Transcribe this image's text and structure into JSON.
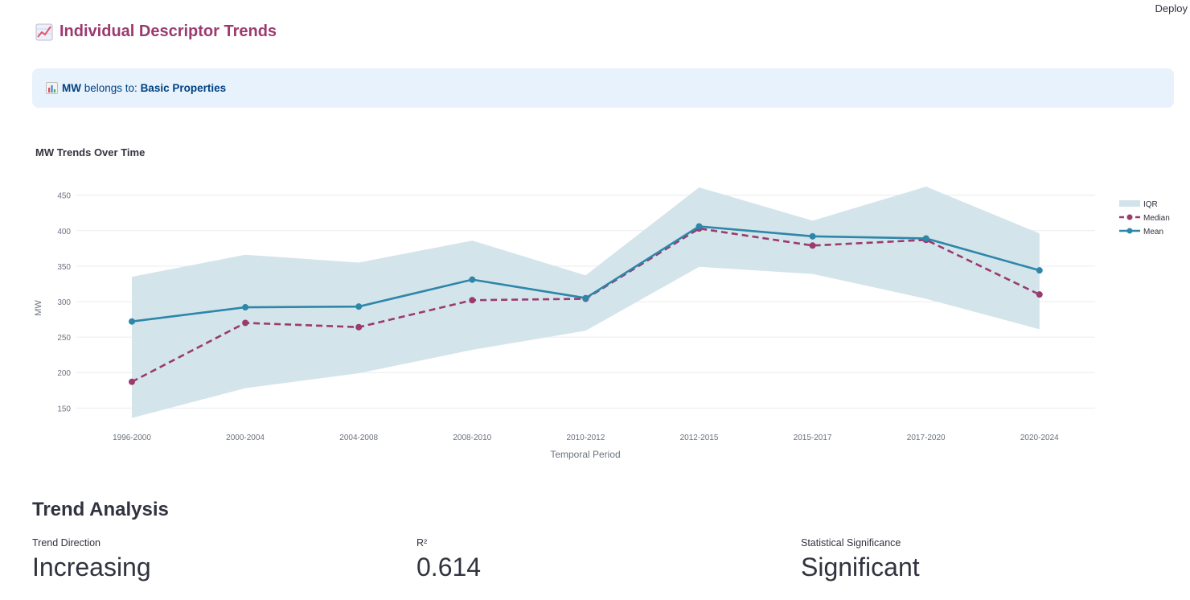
{
  "toolbar": {
    "deploy_label": "Deploy"
  },
  "page": {
    "title": "Individual Descriptor Trends"
  },
  "info": {
    "descriptor": "MW",
    "belongs_text": " belongs to: ",
    "group": "Basic Properties"
  },
  "chart_title": "MW Trends Over Time",
  "chart_data": {
    "type": "line",
    "categories": [
      "1996-2000",
      "2000-2004",
      "2004-2008",
      "2008-2010",
      "2010-2012",
      "2012-2015",
      "2015-2017",
      "2017-2020",
      "2020-2024"
    ],
    "series": [
      {
        "name": "Median",
        "values": [
          187,
          270,
          264,
          302,
          304,
          403,
          379,
          387,
          310
        ],
        "color": "#9b3a6e",
        "dash": true
      },
      {
        "name": "Mean",
        "values": [
          272,
          292,
          293,
          331,
          305,
          406,
          392,
          389,
          344
        ],
        "color": "#2e86a8",
        "dash": false
      }
    ],
    "band": {
      "name": "IQR",
      "upper": [
        335,
        366,
        355,
        386,
        337,
        461,
        414,
        462,
        396
      ],
      "lower": [
        136,
        178,
        199,
        232,
        259,
        349,
        339,
        304,
        261
      ],
      "color": "#d2e3ea"
    },
    "yticks": [
      150,
      200,
      250,
      300,
      350,
      400,
      450
    ],
    "ylim": [
      130,
      470
    ],
    "xlabel": "Temporal Period",
    "ylabel": "MW",
    "legend": "top-right",
    "grid": true
  },
  "trend": {
    "title": "Trend Analysis",
    "metrics": [
      {
        "label": "Trend Direction",
        "value": "Increasing"
      },
      {
        "label": "R²",
        "value": "0.614"
      },
      {
        "label": "Statistical Significance",
        "value": "Significant"
      }
    ]
  }
}
